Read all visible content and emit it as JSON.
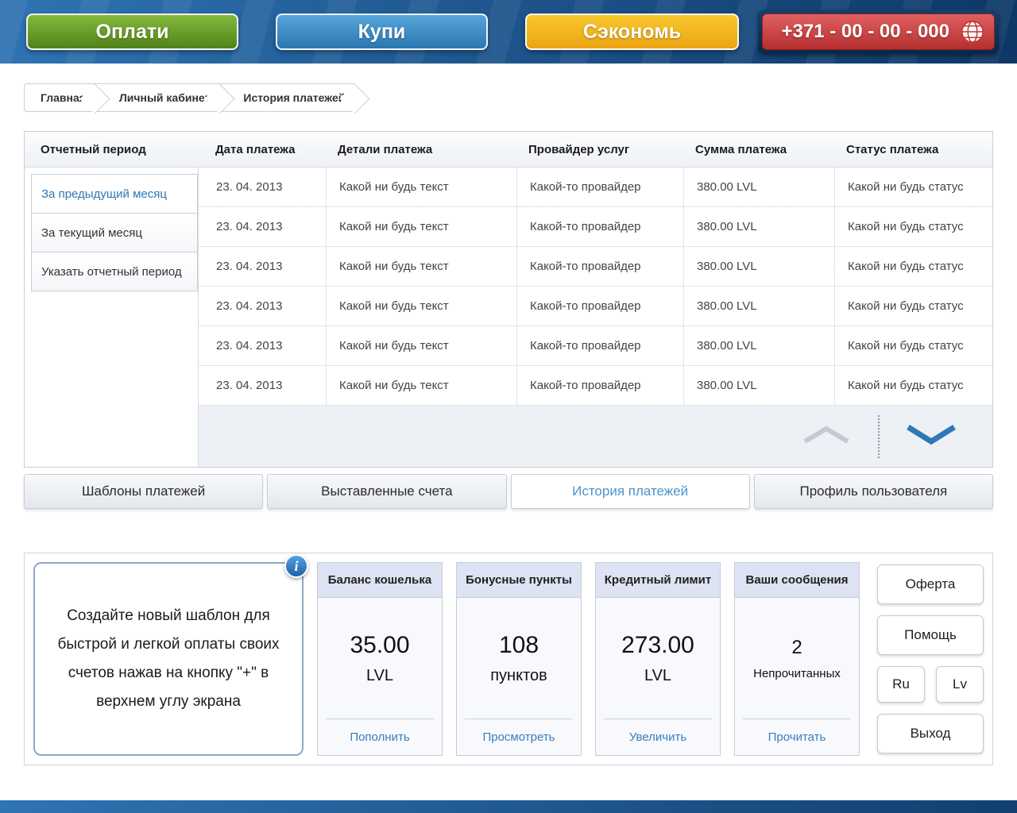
{
  "colors": {
    "header_blue": "#1c5188",
    "green_button": "#6da32c",
    "blue_button": "#3f92cc",
    "yellow_button": "#f2b722",
    "red_button": "#cc3b3b",
    "accent_blue": "#2e77b6",
    "link_blue": "#3a7dbd"
  },
  "header": {
    "pay_button": "Оплати",
    "buy_button": "Купи",
    "save_button": "Сэкономь",
    "phone": "+371 - 00 - 00 - 000"
  },
  "breadcrumb": {
    "home": "Главная",
    "cabinet": "Личный кабинет",
    "history": "История платежей"
  },
  "table": {
    "columns": {
      "period": "Отчетный период",
      "date": "Дата платежа",
      "details": "Детали платежа",
      "provider": "Провайдер услуг",
      "amount": "Сумма платежа",
      "status": "Статус платежа"
    },
    "filters": [
      {
        "label": "За предыдущий месяц"
      },
      {
        "label": "За текущий месяц"
      },
      {
        "label": "Указать отчетный период"
      }
    ],
    "rows": [
      {
        "date": "23. 04.  2013",
        "details": "Какой ни будь текст",
        "provider": "Какой-то провайдер",
        "amount": "380.00 LVL",
        "status": "Какой ни будь статус"
      },
      {
        "date": "23. 04.  2013",
        "details": "Какой ни будь текст",
        "provider": "Какой-то провайдер",
        "amount": "380.00 LVL",
        "status": "Какой ни будь статус"
      },
      {
        "date": "23. 04.  2013",
        "details": "Какой ни будь текст",
        "provider": "Какой-то провайдер",
        "amount": "380.00 LVL",
        "status": "Какой ни будь статус"
      },
      {
        "date": "23. 04.  2013",
        "details": "Какой ни будь текст",
        "provider": "Какой-то провайдер",
        "amount": "380.00 LVL",
        "status": "Какой ни будь статус"
      },
      {
        "date": "23. 04.  2013",
        "details": "Какой ни будь текст",
        "provider": "Какой-то провайдер",
        "amount": "380.00 LVL",
        "status": "Какой ни будь статус"
      },
      {
        "date": "23. 04.  2013",
        "details": "Какой ни будь текст",
        "provider": "Какой-то провайдер",
        "amount": "380.00 LVL",
        "status": "Какой ни будь статус"
      }
    ]
  },
  "tabs": [
    {
      "label": "Шаблоны платежей"
    },
    {
      "label": "Выставленные счета"
    },
    {
      "label": "История платежей"
    },
    {
      "label": "Профиль пользователя"
    }
  ],
  "panel": {
    "hint": "Создайте новый шаблон для быстрой и легкой оплаты своих счетов нажав на кнопку \"+\" в верхнем углу экрана",
    "info_icon": "i",
    "cards": [
      {
        "title": "Баланс кошелька",
        "value": "35.00",
        "unit": "LVL",
        "action": "Пополнить"
      },
      {
        "title": "Бонусные пункты",
        "value": "108",
        "unit": "пунктов",
        "action": "Просмотреть"
      },
      {
        "title": "Кредитный лимит",
        "value": "273.00",
        "unit": "LVL",
        "action": "Увеличить"
      },
      {
        "title": "Ваши сообщения",
        "value": "2",
        "unit": "Непрочитанных",
        "action": "Прочитать"
      }
    ],
    "offer_button": "Оферта",
    "help_button": "Помощь",
    "lang_ru": "Ru",
    "lang_lv": "Lv",
    "exit_button": "Выход"
  }
}
